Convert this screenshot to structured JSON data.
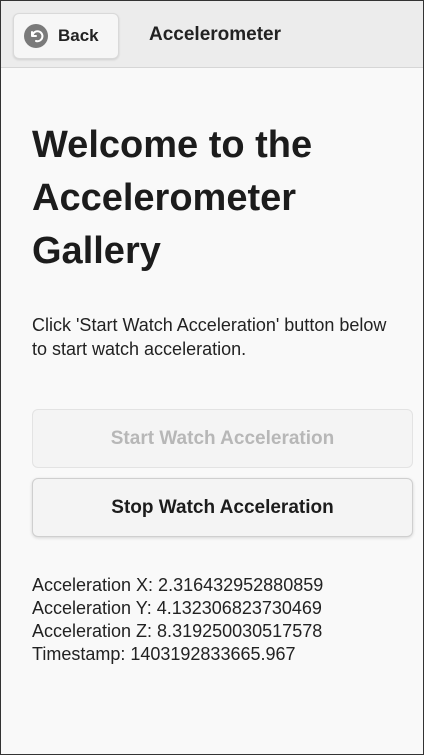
{
  "header": {
    "back_label": "Back",
    "back_icon": "back-arrow-circle-icon",
    "title": "Accelerometer"
  },
  "main": {
    "title": "Welcome to the Accelerometer Gallery",
    "description": "Click 'Start Watch Acceleration' button below to start watch acceleration.",
    "start_button_label": "Start Watch Acceleration",
    "stop_button_label": "Stop Watch Acceleration"
  },
  "readouts": {
    "x": "Acceleration X: 2.316432952880859",
    "y": "Acceleration Y: 4.132306823730469",
    "z": "Acceleration Z: 8.319250030517578",
    "timestamp": "Timestamp: 1403192833665.967"
  },
  "colors": {
    "header_background": "#ececec",
    "page_background": "#f9f9f9",
    "disabled_text": "#b7b7b7",
    "text": "#1c1c1c"
  }
}
